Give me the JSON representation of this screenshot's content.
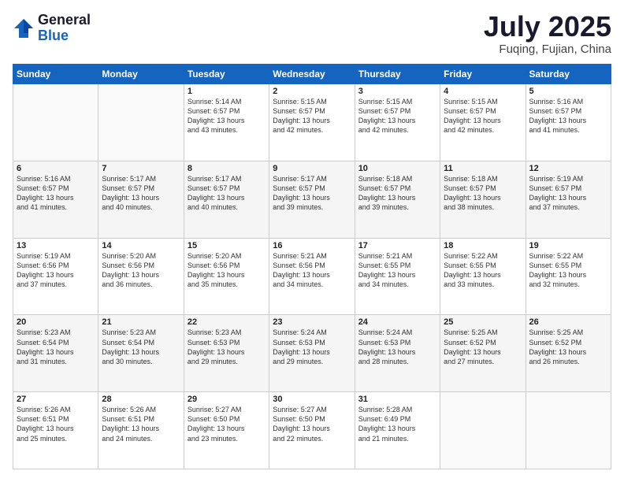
{
  "header": {
    "logo_general": "General",
    "logo_blue": "Blue",
    "month_title": "July 2025",
    "location": "Fuqing, Fujian, China"
  },
  "days_of_week": [
    "Sunday",
    "Monday",
    "Tuesday",
    "Wednesday",
    "Thursday",
    "Friday",
    "Saturday"
  ],
  "weeks": [
    [
      {
        "day": "",
        "info": ""
      },
      {
        "day": "",
        "info": ""
      },
      {
        "day": "1",
        "info": "Sunrise: 5:14 AM\nSunset: 6:57 PM\nDaylight: 13 hours\nand 43 minutes."
      },
      {
        "day": "2",
        "info": "Sunrise: 5:15 AM\nSunset: 6:57 PM\nDaylight: 13 hours\nand 42 minutes."
      },
      {
        "day": "3",
        "info": "Sunrise: 5:15 AM\nSunset: 6:57 PM\nDaylight: 13 hours\nand 42 minutes."
      },
      {
        "day": "4",
        "info": "Sunrise: 5:15 AM\nSunset: 6:57 PM\nDaylight: 13 hours\nand 42 minutes."
      },
      {
        "day": "5",
        "info": "Sunrise: 5:16 AM\nSunset: 6:57 PM\nDaylight: 13 hours\nand 41 minutes."
      }
    ],
    [
      {
        "day": "6",
        "info": "Sunrise: 5:16 AM\nSunset: 6:57 PM\nDaylight: 13 hours\nand 41 minutes."
      },
      {
        "day": "7",
        "info": "Sunrise: 5:17 AM\nSunset: 6:57 PM\nDaylight: 13 hours\nand 40 minutes."
      },
      {
        "day": "8",
        "info": "Sunrise: 5:17 AM\nSunset: 6:57 PM\nDaylight: 13 hours\nand 40 minutes."
      },
      {
        "day": "9",
        "info": "Sunrise: 5:17 AM\nSunset: 6:57 PM\nDaylight: 13 hours\nand 39 minutes."
      },
      {
        "day": "10",
        "info": "Sunrise: 5:18 AM\nSunset: 6:57 PM\nDaylight: 13 hours\nand 39 minutes."
      },
      {
        "day": "11",
        "info": "Sunrise: 5:18 AM\nSunset: 6:57 PM\nDaylight: 13 hours\nand 38 minutes."
      },
      {
        "day": "12",
        "info": "Sunrise: 5:19 AM\nSunset: 6:57 PM\nDaylight: 13 hours\nand 37 minutes."
      }
    ],
    [
      {
        "day": "13",
        "info": "Sunrise: 5:19 AM\nSunset: 6:56 PM\nDaylight: 13 hours\nand 37 minutes."
      },
      {
        "day": "14",
        "info": "Sunrise: 5:20 AM\nSunset: 6:56 PM\nDaylight: 13 hours\nand 36 minutes."
      },
      {
        "day": "15",
        "info": "Sunrise: 5:20 AM\nSunset: 6:56 PM\nDaylight: 13 hours\nand 35 minutes."
      },
      {
        "day": "16",
        "info": "Sunrise: 5:21 AM\nSunset: 6:56 PM\nDaylight: 13 hours\nand 34 minutes."
      },
      {
        "day": "17",
        "info": "Sunrise: 5:21 AM\nSunset: 6:55 PM\nDaylight: 13 hours\nand 34 minutes."
      },
      {
        "day": "18",
        "info": "Sunrise: 5:22 AM\nSunset: 6:55 PM\nDaylight: 13 hours\nand 33 minutes."
      },
      {
        "day": "19",
        "info": "Sunrise: 5:22 AM\nSunset: 6:55 PM\nDaylight: 13 hours\nand 32 minutes."
      }
    ],
    [
      {
        "day": "20",
        "info": "Sunrise: 5:23 AM\nSunset: 6:54 PM\nDaylight: 13 hours\nand 31 minutes."
      },
      {
        "day": "21",
        "info": "Sunrise: 5:23 AM\nSunset: 6:54 PM\nDaylight: 13 hours\nand 30 minutes."
      },
      {
        "day": "22",
        "info": "Sunrise: 5:23 AM\nSunset: 6:53 PM\nDaylight: 13 hours\nand 29 minutes."
      },
      {
        "day": "23",
        "info": "Sunrise: 5:24 AM\nSunset: 6:53 PM\nDaylight: 13 hours\nand 29 minutes."
      },
      {
        "day": "24",
        "info": "Sunrise: 5:24 AM\nSunset: 6:53 PM\nDaylight: 13 hours\nand 28 minutes."
      },
      {
        "day": "25",
        "info": "Sunrise: 5:25 AM\nSunset: 6:52 PM\nDaylight: 13 hours\nand 27 minutes."
      },
      {
        "day": "26",
        "info": "Sunrise: 5:25 AM\nSunset: 6:52 PM\nDaylight: 13 hours\nand 26 minutes."
      }
    ],
    [
      {
        "day": "27",
        "info": "Sunrise: 5:26 AM\nSunset: 6:51 PM\nDaylight: 13 hours\nand 25 minutes."
      },
      {
        "day": "28",
        "info": "Sunrise: 5:26 AM\nSunset: 6:51 PM\nDaylight: 13 hours\nand 24 minutes."
      },
      {
        "day": "29",
        "info": "Sunrise: 5:27 AM\nSunset: 6:50 PM\nDaylight: 13 hours\nand 23 minutes."
      },
      {
        "day": "30",
        "info": "Sunrise: 5:27 AM\nSunset: 6:50 PM\nDaylight: 13 hours\nand 22 minutes."
      },
      {
        "day": "31",
        "info": "Sunrise: 5:28 AM\nSunset: 6:49 PM\nDaylight: 13 hours\nand 21 minutes."
      },
      {
        "day": "",
        "info": ""
      },
      {
        "day": "",
        "info": ""
      }
    ]
  ]
}
